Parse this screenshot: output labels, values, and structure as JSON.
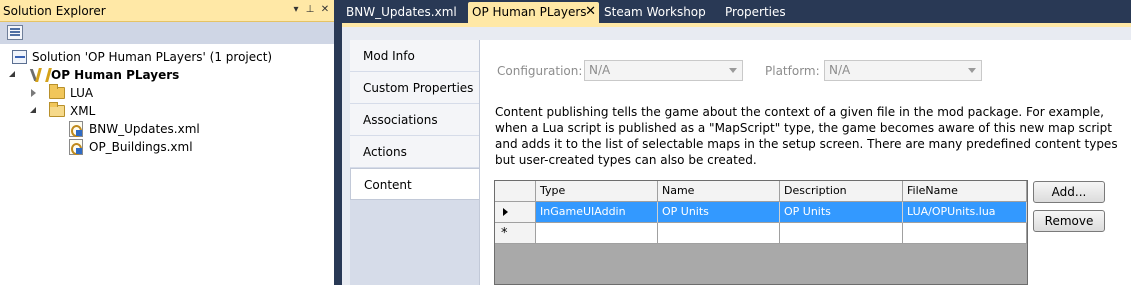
{
  "solution_explorer": {
    "title": "Solution Explorer",
    "pin_icon": "pin-icon",
    "dropdown_icon": "chevron-down-icon",
    "close_icon": "close-icon",
    "tree": {
      "solution": "Solution 'OP Human PLayers' (1 project)",
      "project": "OP Human PLayers",
      "folder_lua": "LUA",
      "folder_xml": "XML",
      "file_1": "BNW_Updates.xml",
      "file_2": "OP_Buildings.xml"
    }
  },
  "document_tabs": {
    "tab_1": "BNW_Updates.xml",
    "tab_2": "OP Human PLayers",
    "tab_2_close": "✕",
    "tab_3": "Steam Workshop",
    "tab_4": "Properties"
  },
  "property_tabs": {
    "mod_info": "Mod Info",
    "custom_properties": "Custom Properties",
    "associations": "Associations",
    "actions": "Actions",
    "content": "Content"
  },
  "content_page": {
    "configuration_label": "Configuration:",
    "configuration_value": "N/A",
    "platform_label": "Platform:",
    "platform_value": "N/A",
    "description": [
      "Content publishing tells  the game about the context of a given file in the mod package.  For example,",
      "when a Lua script is published as a \"MapScript\" type, the game becomes aware of this new map script",
      "and adds it to the list of selectable maps in the setup screen.  There are many predefined content types",
      "but user-created types can also be created."
    ],
    "grid": {
      "headers": [
        "Type",
        "Name",
        "Description",
        "FileName"
      ],
      "rows": [
        [
          "InGameUIAddin",
          "OP Units",
          "OP Units",
          "LUA/OPUnits.lua"
        ]
      ],
      "new_row_marker": "*"
    },
    "add_button": "Add...",
    "remove_button": "Remove"
  }
}
